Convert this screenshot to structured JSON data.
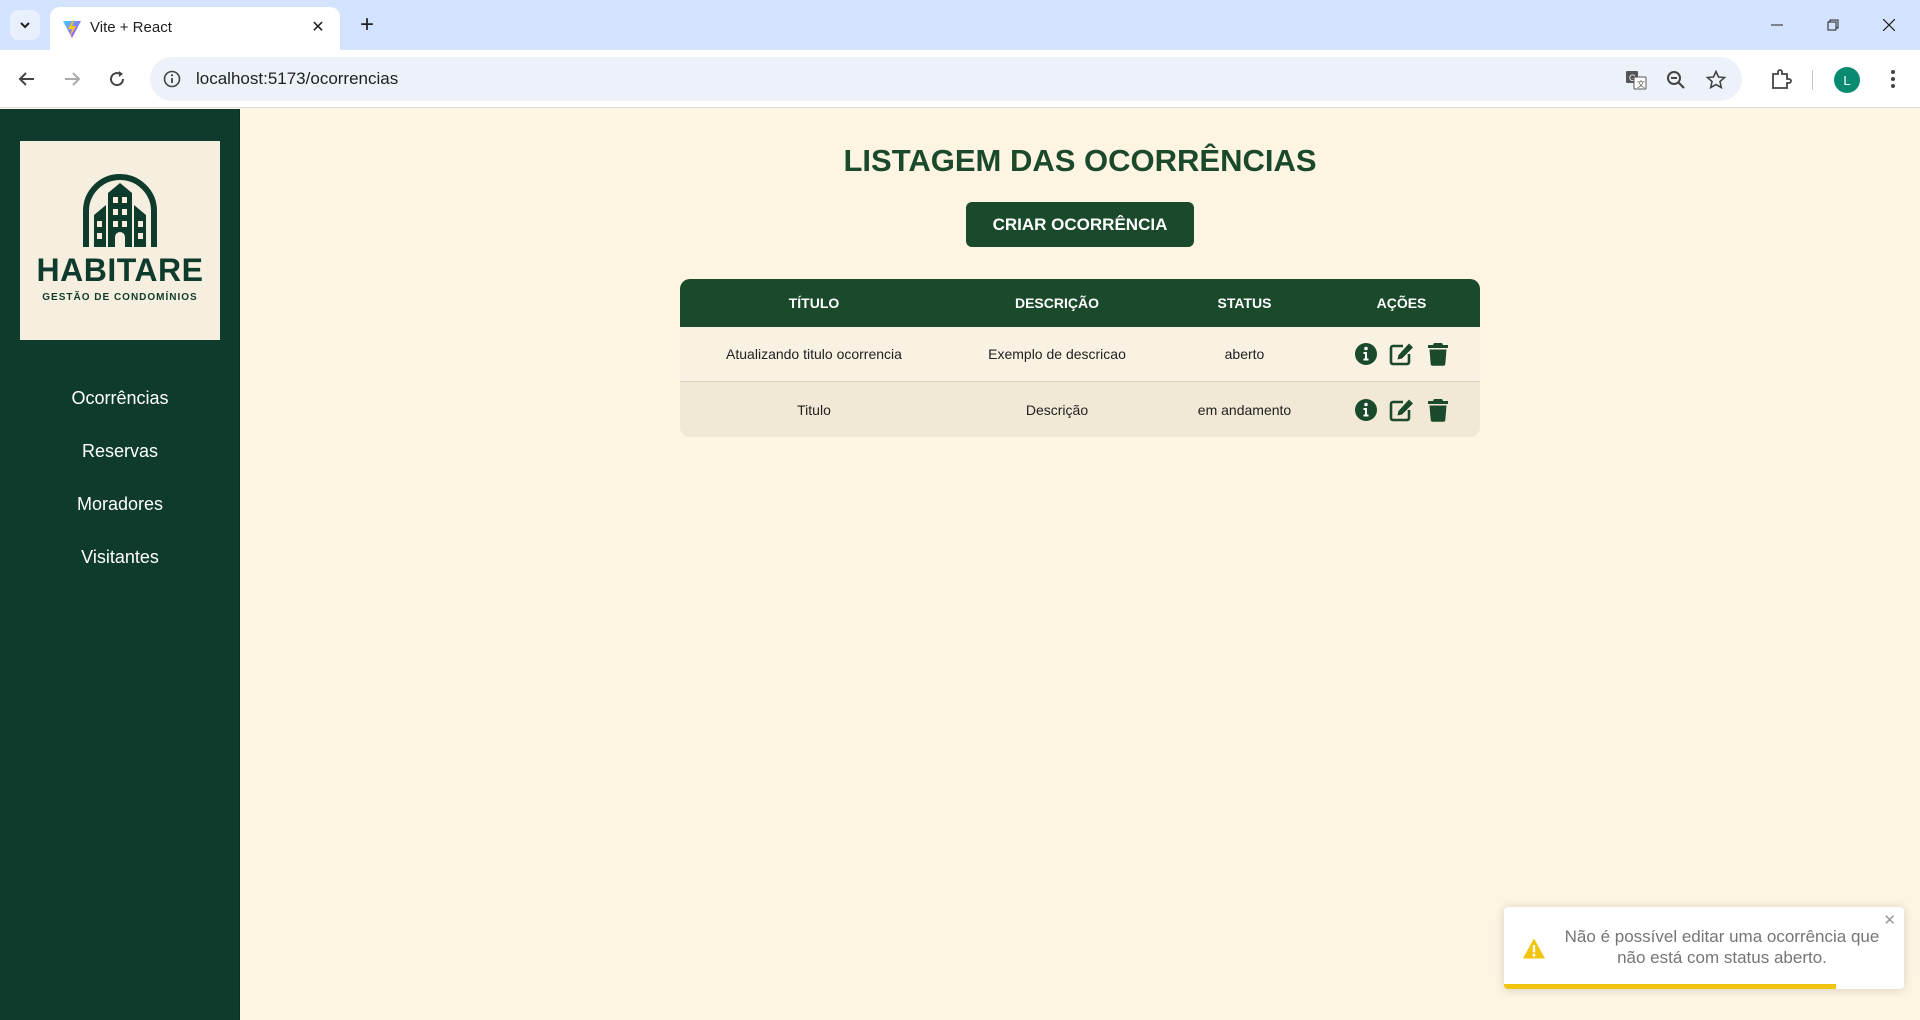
{
  "browser": {
    "tab_title": "Vite + React",
    "url": "localhost:5173/ocorrencias",
    "profile_initial": "L"
  },
  "sidebar": {
    "logo": {
      "name": "HABITARE",
      "tagline": "GESTÃO DE CONDOMÍNIOS"
    },
    "items": [
      {
        "label": "Ocorrências"
      },
      {
        "label": "Reservas"
      },
      {
        "label": "Moradores"
      },
      {
        "label": "Visitantes"
      }
    ]
  },
  "main": {
    "title": "LISTAGEM DAS OCORRÊNCIAS",
    "create_button": "CRIAR OCORRÊNCIA",
    "table": {
      "headers": [
        "TÍTULO",
        "DESCRIÇÃO",
        "STATUS",
        "AÇÕES"
      ],
      "rows": [
        {
          "titulo": "Atualizando titulo ocorrencia",
          "descricao": "Exemplo de descricao",
          "status": "aberto"
        },
        {
          "titulo": "Titulo",
          "descricao": "Descrição",
          "status": "em andamento"
        }
      ],
      "action_icons": [
        "info-icon",
        "edit-icon",
        "trash-icon"
      ]
    }
  },
  "toast": {
    "type": "warning",
    "message": "Não é possível editar uma ocorrência que não está com status aberto.",
    "progress": 0.83
  },
  "colors": {
    "sidebar": "#0e3b2c",
    "accent": "#1a4a2b",
    "background": "#fdf4e2",
    "warning": "#f1c40f"
  }
}
